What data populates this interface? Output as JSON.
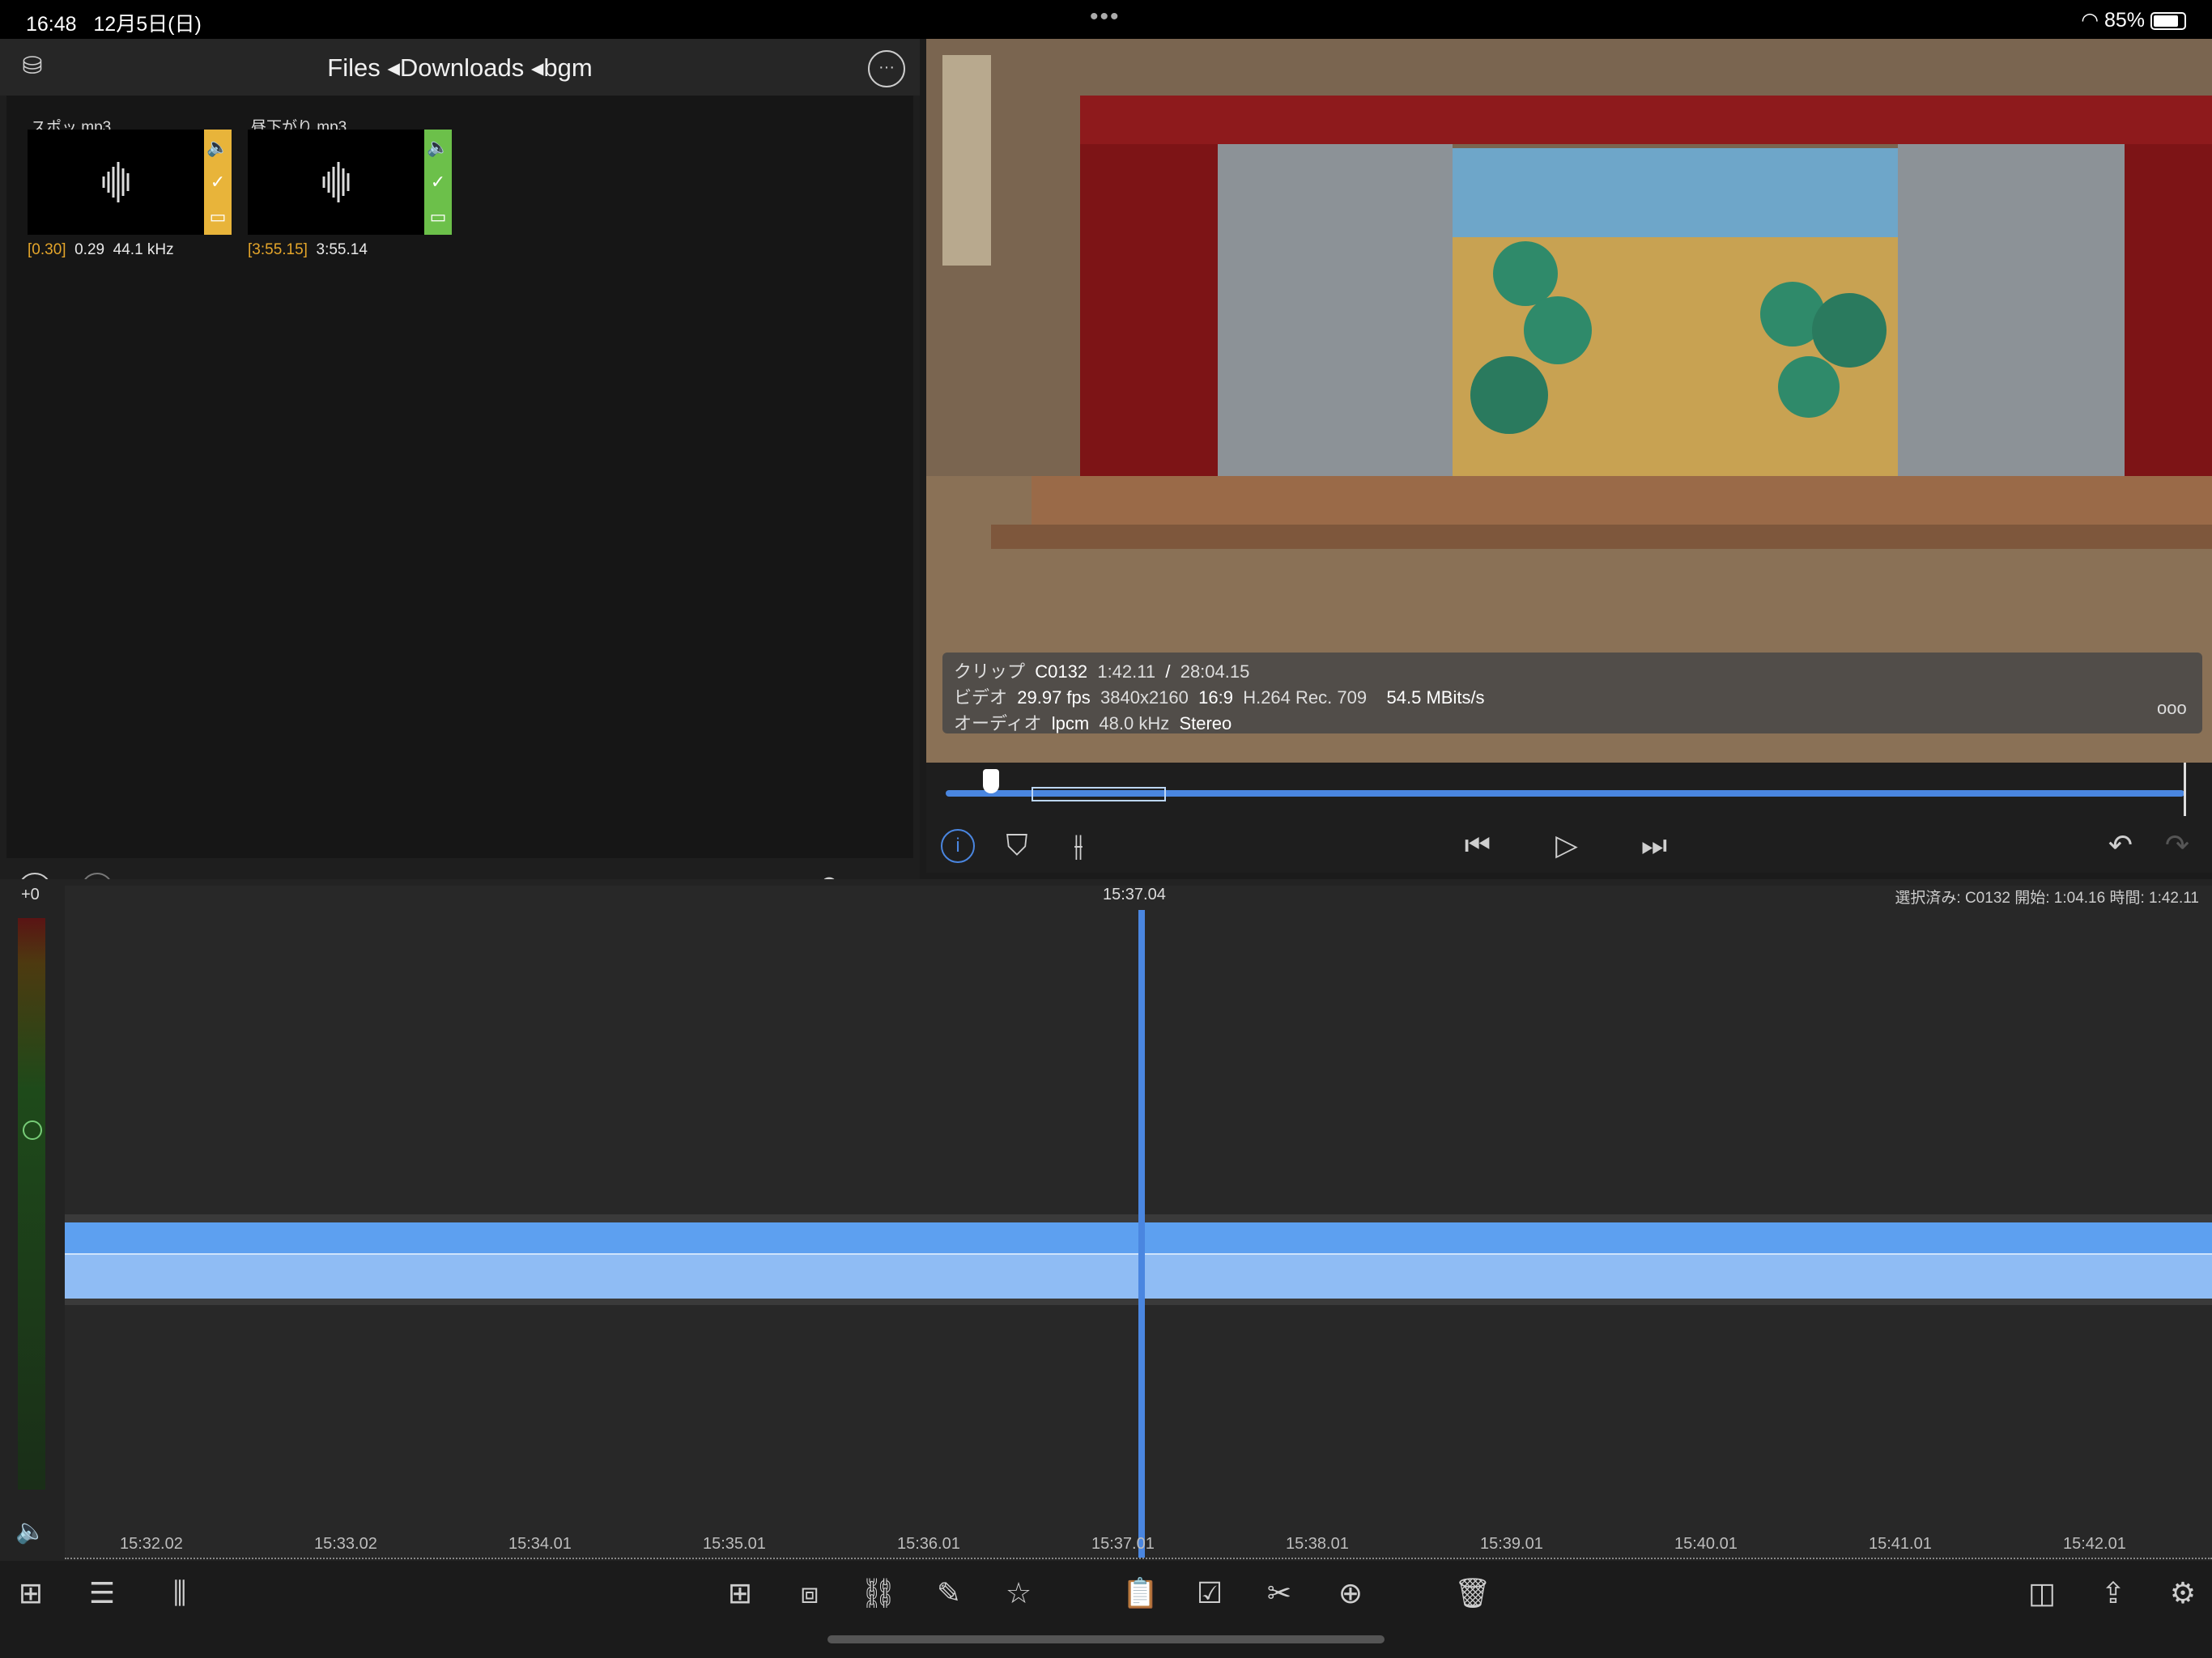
{
  "status": {
    "time": "16:48",
    "date": "12月5日(日)",
    "dots": "•••",
    "battery": "85%"
  },
  "browser": {
    "breadcrumb": "Files ◂Downloads ◂bgm",
    "clips": [
      {
        "name": "スポッ.mp3",
        "in_point": "[0.30]",
        "duration": "0.29",
        "rate": "44.1 kHz",
        "tag_color": "#e8b43a"
      },
      {
        "name": "昼下がり.mp3",
        "in_point": "[3:55.15]",
        "duration": "3:55.14",
        "rate": "",
        "tag_color": "#6cc04a"
      }
    ]
  },
  "info": {
    "clip_label": "クリップ",
    "clip_name": "C0132",
    "clip_pos": "1:42.11",
    "sep": "/",
    "clip_total": "28:04.15",
    "video_label": "ビデオ",
    "fps": "29.97 fps",
    "res": "3840x2160",
    "aspect": "16:9",
    "codec": "H.264 Rec. 709",
    "bitrate": "54.5 MBits/s",
    "audio_label": "オーディオ",
    "audio_codec": "lpcm",
    "audio_rate": "48.0 kHz",
    "audio_ch": "Stereo",
    "more": "ooo"
  },
  "timeline": {
    "gain": "+0",
    "playhead_time": "15:37.04",
    "selection_info": "選択済み: C0132 開始: 1:04.16 時間: 1:42.11",
    "ticks": [
      "15:32.02",
      "15:33.02",
      "15:34.01",
      "15:35.01",
      "15:36.01",
      "15:37.01",
      "15:38.01",
      "15:39.01",
      "15:40.01",
      "15:41.01",
      "15:42.01"
    ]
  },
  "colors": {
    "accent": "#4a86e0",
    "audio_track": "#8fbcf4",
    "audio_top": "#5da0f0"
  }
}
